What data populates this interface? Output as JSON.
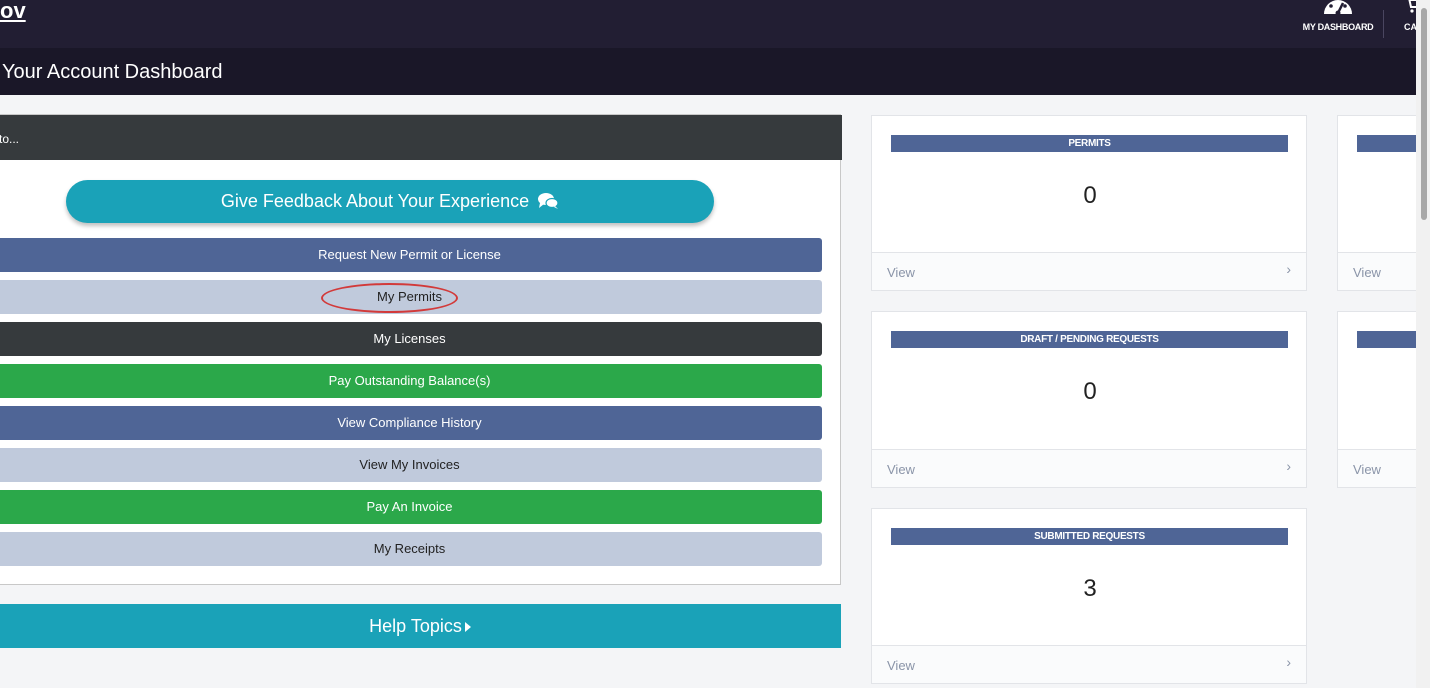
{
  "header": {
    "logo_text": "ov",
    "dashboard_label": "MY DASHBOARD",
    "cart_label": "CA"
  },
  "subheader": {
    "title": "Your Account Dashboard"
  },
  "panel": {
    "heading": "to...",
    "feedback_label": "Give Feedback About Your Experience",
    "actions": [
      {
        "label": "Request New Permit or License",
        "style": "blue"
      },
      {
        "label": "My Permits",
        "style": "light"
      },
      {
        "label": "My Licenses",
        "style": "dark"
      },
      {
        "label": "Pay Outstanding Balance(s)",
        "style": "green"
      },
      {
        "label": "View Compliance History",
        "style": "blue"
      },
      {
        "label": "View My Invoices",
        "style": "light"
      },
      {
        "label": "Pay An Invoice",
        "style": "green"
      },
      {
        "label": "My Receipts",
        "style": "light"
      }
    ],
    "help_label": "Help Topics"
  },
  "cards": [
    {
      "title": "PERMITS",
      "value": "0",
      "view": "View"
    },
    {
      "title": "DRAFT / PENDING REQUESTS",
      "value": "0",
      "view": "View"
    },
    {
      "title": "SUBMITTED REQUESTS",
      "value": "3",
      "view": "View"
    }
  ],
  "side_cards": [
    {
      "view": "View"
    },
    {
      "view": "View"
    }
  ],
  "colors": {
    "topbar": "#221e33",
    "subheader": "#1a1728",
    "accent_teal": "#1aa2b8",
    "action_blue": "#4f6596",
    "action_light": "#c0cadc",
    "action_dark": "#363a3d",
    "action_green": "#2ba84a",
    "highlight_ring": "#d23a3a"
  }
}
